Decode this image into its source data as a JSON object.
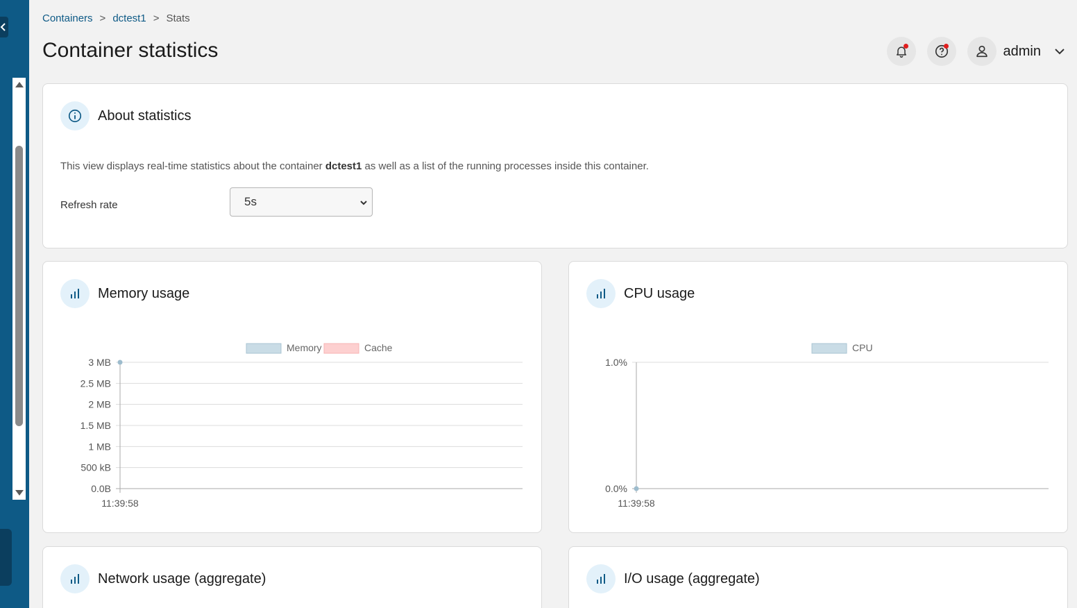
{
  "breadcrumb": {
    "containers": "Containers",
    "container": "dctest1",
    "current": "Stats",
    "sep": ">"
  },
  "page_title": "Container statistics",
  "header": {
    "user": "admin"
  },
  "about": {
    "title": "About statistics",
    "text_before": "This view displays real-time statistics about the container ",
    "container": "dctest1",
    "text_after": " as well as a list of the running processes inside this container.",
    "refresh_label": "Refresh rate",
    "refresh_value": "5s"
  },
  "cards": {
    "memory_title": "Memory usage",
    "cpu_title": "CPU usage",
    "network_title": "Network usage (aggregate)",
    "io_title": "I/O usage (aggregate)"
  },
  "colors": {
    "accent": "#0e5a86",
    "memory": "#c9dce6",
    "cache": "#fdd0d0",
    "cpu": "#c9dce6"
  },
  "chart_data": [
    {
      "type": "line",
      "legend": [
        {
          "name": "Memory",
          "color": "#c9dce6"
        },
        {
          "name": "Cache",
          "color": "#fdd0d0"
        }
      ],
      "yticks": [
        "3 MB",
        "2.5 MB",
        "2 MB",
        "1.5 MB",
        "1 MB",
        "500 kB",
        "0.0B"
      ],
      "xticks": [
        "11:39:58"
      ],
      "series": [
        {
          "name": "Memory",
          "x": [
            "11:39:58"
          ],
          "y": [
            3
          ]
        }
      ],
      "ylim": [
        0,
        3
      ],
      "grid": true,
      "legend_position": "top"
    },
    {
      "type": "line",
      "legend": [
        {
          "name": "CPU",
          "color": "#c9dce6"
        }
      ],
      "yticks": [
        "1.0%",
        "0.0%"
      ],
      "xticks": [
        "11:39:58"
      ],
      "series": [
        {
          "name": "CPU",
          "x": [
            "11:39:58"
          ],
          "y": [
            0
          ]
        }
      ],
      "ylim": [
        0,
        1
      ],
      "grid": true,
      "legend_position": "top"
    }
  ]
}
